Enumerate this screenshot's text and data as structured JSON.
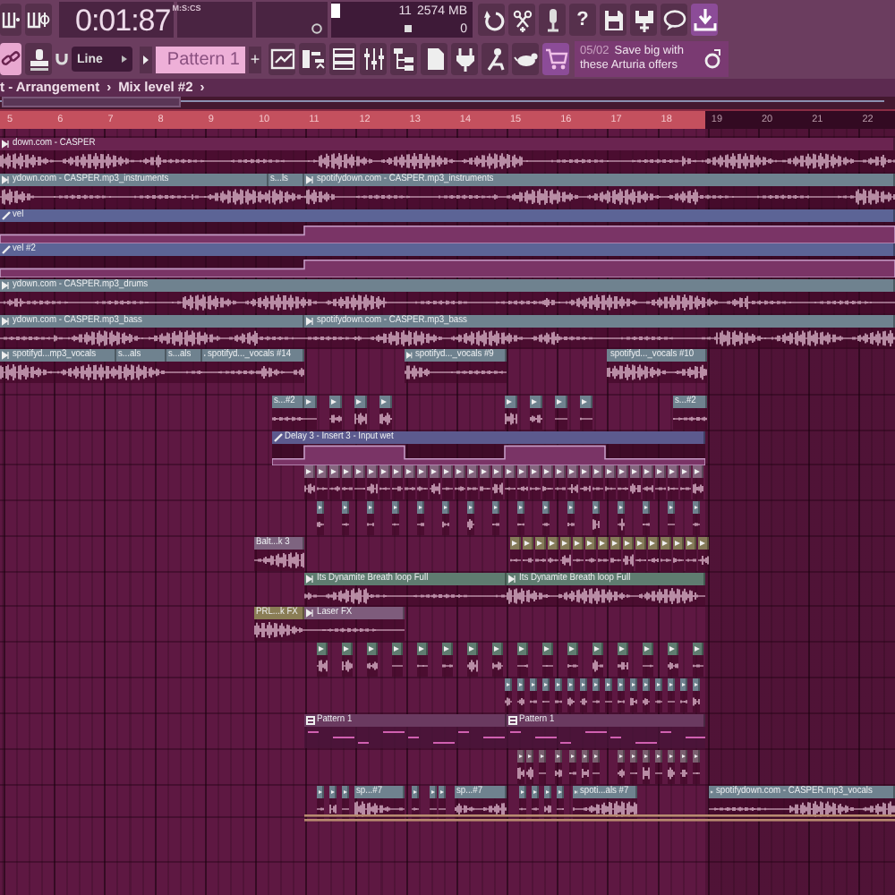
{
  "toolbar": {
    "time": "0:01:87",
    "time_format": "M:S:CS",
    "cpu": "11",
    "memory": "2574 MB",
    "polyphony": "0",
    "buttons_top": [
      {
        "on": false
      },
      {
        "on": false
      },
      {
        "on": false
      },
      {
        "on": false,
        "label": "?"
      },
      {
        "on": false
      },
      {
        "on": false
      },
      {
        "on": false
      },
      {
        "on": true
      }
    ],
    "buttons_left": [
      {
        "on": true
      },
      {
        "on": false
      }
    ],
    "snap": "Line",
    "pattern": "Pattern 1",
    "add_pattern": "+",
    "view_buttons": [
      {
        "on": false
      },
      {
        "on": false
      },
      {
        "on": false
      },
      {
        "on": false
      },
      {
        "on": false
      },
      {
        "on": false
      },
      {
        "on": false
      },
      {
        "on": false
      },
      {
        "on": false
      },
      {
        "on": true
      }
    ],
    "news": {
      "date": "05/02",
      "text": "Save big with these Arturia offers"
    }
  },
  "breadcrumb": [
    {
      "label": "t - Arrangement",
      "separator": "›"
    },
    {
      "label": "Mix level #2",
      "separator": "›"
    }
  ],
  "ruler": [
    "5",
    "6",
    "7",
    "8",
    "9",
    "10",
    "11",
    "12",
    "13",
    "14",
    "15",
    "16",
    "17",
    "18",
    "19",
    "20",
    "21",
    "22"
  ],
  "tracks": [
    {
      "clips": [
        {
          "label": "down.com - CASPER",
          "kind": "audio",
          "color": "#6a2450"
        }
      ]
    },
    {
      "clips": [
        {
          "label": "ydown.com - CASPER.mp3_instruments",
          "kind": "audio",
          "color": "#6f828f"
        },
        {
          "label": "s...ls",
          "kind": "audio",
          "color": "#6f828f"
        },
        {
          "label": "spotifydown.com - CASPER.mp3_instruments",
          "kind": "audio",
          "color": "#6f828f"
        }
      ]
    },
    {
      "clips": [
        {
          "label": "vel",
          "kind": "automation",
          "color": "#5c6496"
        }
      ]
    },
    {
      "clips": [
        {
          "label": "vel #2",
          "kind": "automation",
          "color": "#5c6496"
        }
      ]
    },
    {
      "clips": [
        {
          "label": "ydown.com - CASPER.mp3_drums",
          "kind": "audio",
          "color": "#6f828f"
        }
      ]
    },
    {
      "clips": [
        {
          "label": "ydown.com - CASPER.mp3_bass",
          "kind": "audio",
          "color": "#6f828f"
        },
        {
          "label": "spotifydown.com - CASPER.mp3_bass",
          "kind": "audio",
          "color": "#6f828f"
        }
      ]
    },
    {
      "clips": [
        {
          "label": "spotifyd...mp3_vocals",
          "kind": "audio",
          "color": "#6f828f"
        },
        {
          "label": "s...als",
          "kind": "audio",
          "color": "#6f828f"
        },
        {
          "label": "s...als",
          "kind": "audio",
          "color": "#6f828f"
        },
        {
          "label": "spotifyd..._vocals #14",
          "kind": "audio",
          "color": "#6f828f"
        },
        {
          "label": "spotifyd..._vocals #9",
          "kind": "audio",
          "color": "#6f828f"
        },
        {
          "label": "spotifyd..._vocals #10",
          "kind": "audio",
          "color": "#6f828f"
        }
      ]
    },
    {
      "clips": [
        {
          "label": "s...#2",
          "kind": "audio",
          "color": "#6f828f"
        },
        {
          "label": "s...#2",
          "kind": "audio",
          "color": "#6f828f"
        }
      ]
    },
    {
      "clips": [
        {
          "label": "Delay 3 - Insert 3 - Input wet",
          "kind": "automation",
          "color": "#5c5a8e"
        }
      ]
    },
    {
      "clips": [
        {
          "label": "Balt...k 3",
          "kind": "audio",
          "color": "#7e6480"
        }
      ]
    },
    {
      "clips": [
        {
          "label": "Its Dynamite Breath loop Full",
          "kind": "audio",
          "color": "#5f7c70"
        },
        {
          "label": "Its Dynamite Breath loop Full",
          "kind": "audio",
          "color": "#5f7c70"
        }
      ]
    },
    {
      "clips": [
        {
          "label": "PRL...k FX",
          "kind": "audio",
          "color": "#8a7d55"
        },
        {
          "label": "Laser FX",
          "kind": "audio",
          "color": "#7e5c7c"
        }
      ]
    },
    {
      "clips": [
        {
          "label": "Pattern 1",
          "kind": "pattern",
          "color": "#6a3a60"
        },
        {
          "label": "Pattern 1",
          "kind": "pattern",
          "color": "#6a3a60"
        }
      ]
    },
    {
      "clips": [
        {
          "label": "sp...#7",
          "kind": "audio",
          "color": "#6f828f"
        },
        {
          "label": "sp...#7",
          "kind": "audio",
          "color": "#6f828f"
        },
        {
          "label": "spoti...als #7",
          "kind": "audio",
          "color": "#6f828f"
        },
        {
          "label": "spotifydown.com - CASPER.mp3_vocals",
          "kind": "audio",
          "color": "#6f828f"
        }
      ]
    }
  ]
}
